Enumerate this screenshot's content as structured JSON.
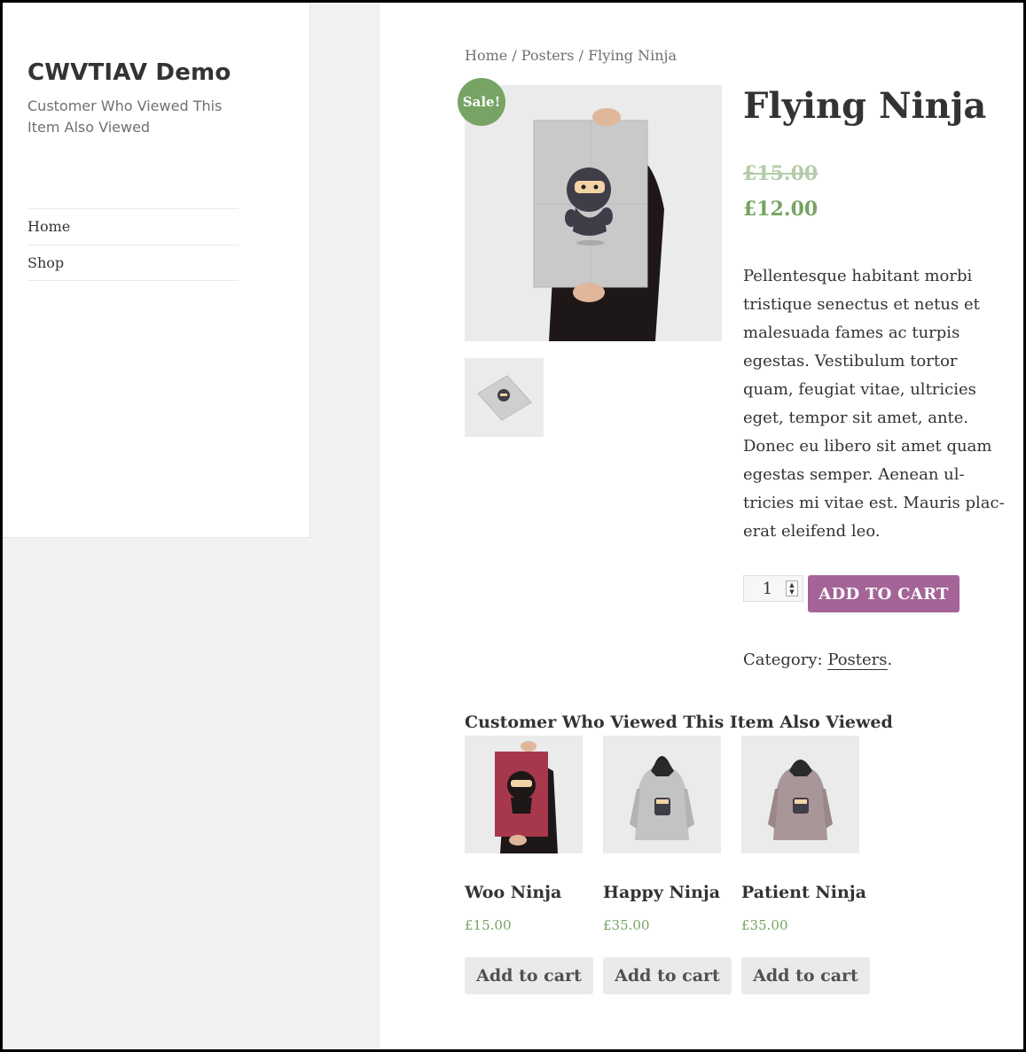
{
  "site": {
    "title": "CWVTIAV Demo",
    "description": "Customer Who Viewed This Item Also Viewed"
  },
  "menu": {
    "items": [
      {
        "label": "Home"
      },
      {
        "label": "Shop"
      }
    ]
  },
  "breadcrumb": {
    "home": "Home",
    "sep1": " / ",
    "category": "Posters",
    "sep2": " / ",
    "current": "Flying Ninja"
  },
  "product": {
    "sale_badge": "Sale!",
    "title": "Flying Ninja",
    "price_old": "£15.00",
    "price_new": "£12.00",
    "description": "Pellentesque habitant morbi tristique senectus et netus et malesuada fames ac turpis egestas. Vestibulum tortor quam, feugiat vitae, ultricies eget, tempor sit amet, ante. Donec eu libero sit amet quam egestas semper. Aenean ul-tricies mi vitae est. Mauris plac-erat eleifend leo.",
    "quantity": "1",
    "add_to_cart_label": "ADD TO CART",
    "category_label": "Category: ",
    "category_value": "Posters",
    "category_suffix": "."
  },
  "related": {
    "heading": "Customer Who Viewed This Item Also Viewed",
    "items": [
      {
        "name": "Woo Ninja",
        "price": "£15.00",
        "button": "Add to cart"
      },
      {
        "name": "Happy Ninja",
        "price": "£35.00",
        "button": "Add to cart"
      },
      {
        "name": "Patient Ninja",
        "price": "£35.00",
        "button": "Add to cart"
      }
    ]
  },
  "colors": {
    "accent_green": "#77a464",
    "button_purple": "#a46497"
  }
}
